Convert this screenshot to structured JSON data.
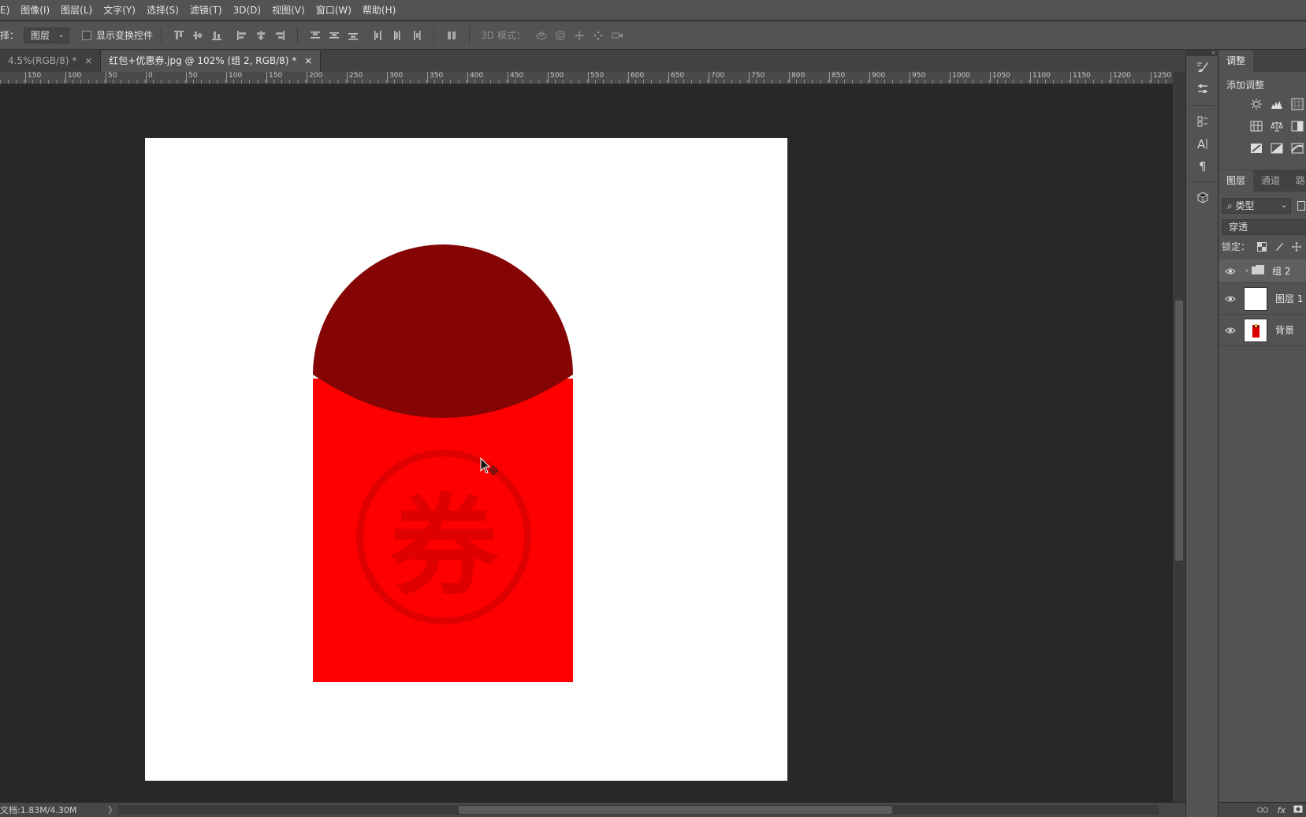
{
  "menu": [
    "E)",
    "图像(I)",
    "图层(L)",
    "文字(Y)",
    "选择(S)",
    "滤镜(T)",
    "3D(D)",
    "视图(V)",
    "窗口(W)",
    "帮助(H)"
  ],
  "options": {
    "select_label": "择：",
    "select_value": "图层",
    "show_transform_label": "显示变换控件",
    "mode3d_label": "3D 模式："
  },
  "tabs": [
    {
      "label": "4.5%(RGB/8) *",
      "close": "×"
    },
    {
      "label": "红包+优惠券.jpg @ 102% (组 2, RGB/8) *",
      "close": "×"
    }
  ],
  "ruler": [
    "150",
    "100",
    "50",
    "0",
    "50",
    "100",
    "150",
    "200",
    "250",
    "300",
    "350",
    "400",
    "450",
    "500",
    "550",
    "600",
    "650",
    "700",
    "750",
    "800",
    "850",
    "900",
    "950",
    "1000",
    "1050",
    "1100",
    "1150",
    "1200",
    "1250"
  ],
  "canvas": {
    "coupon_char": "券",
    "colors": {
      "envelope_body": "#ff0000",
      "envelope_flap": "#850505",
      "coupon_mark": "#df0000",
      "document": "#ffffff"
    }
  },
  "status": {
    "doc_info": "文档:1.83M/4.30M",
    "arrow": "〉"
  },
  "panels": {
    "collapse": "«",
    "adjust_tab": "调整",
    "adjust_title": "添加调整",
    "layer_tabs": [
      "图层",
      "通道",
      "路"
    ],
    "filter_label": "类型",
    "blend_mode": "穿透",
    "lock_label": "锁定：",
    "layers": [
      {
        "name": "组 2",
        "type": "group"
      },
      {
        "name": "图层 1",
        "type": "layer"
      },
      {
        "name": "背景",
        "type": "background"
      }
    ],
    "footer_fx": "fx"
  }
}
